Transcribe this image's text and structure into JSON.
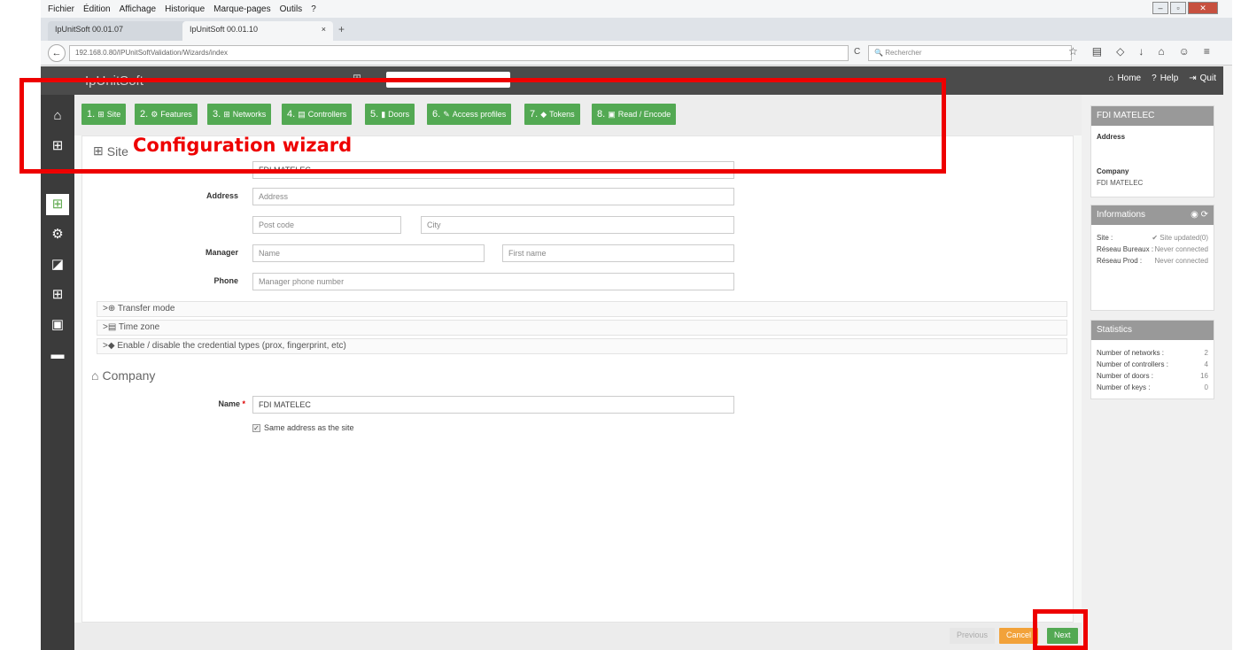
{
  "browser": {
    "menu": [
      "Fichier",
      "Édition",
      "Affichage",
      "Historique",
      "Marque-pages",
      "Outils",
      "?"
    ],
    "tabs": [
      {
        "label": "IpUnitSoft 00.01.07",
        "close": "×"
      },
      {
        "label": "IpUnitSoft 00.01.10",
        "close": "×"
      }
    ],
    "new_tab": "+",
    "url": "192.168.0.80/IPUnitSoftValidation/Wizards/index",
    "search_placeholder": "Rechercher",
    "back": "←",
    "reload": "C"
  },
  "app": {
    "logo": "IpUnitSoft",
    "header_links": {
      "home": "Home",
      "help": "Help",
      "quit": "Quit"
    }
  },
  "wizard": {
    "steps": [
      {
        "num": "1.",
        "icon": "⊞",
        "label": "Site"
      },
      {
        "num": "2.",
        "icon": "⚙",
        "label": "Features"
      },
      {
        "num": "3.",
        "icon": "⊞",
        "label": "Networks"
      },
      {
        "num": "4.",
        "icon": "▤",
        "label": "Controllers"
      },
      {
        "num": "5.",
        "icon": "▮",
        "label": "Doors"
      },
      {
        "num": "6.",
        "icon": "✎",
        "label": "Access profiles"
      },
      {
        "num": "7.",
        "icon": "◆",
        "label": "Tokens"
      },
      {
        "num": "8.",
        "icon": "▣",
        "label": "Read / Encode"
      }
    ]
  },
  "site": {
    "title": "Site",
    "name_value": "FDI MATELEC",
    "address_label": "Address",
    "address_placeholder": "Address",
    "postcode_placeholder": "Post code",
    "city_placeholder": "City",
    "manager_label": "Manager",
    "manager_name_placeholder": "Name",
    "manager_firstname_placeholder": "First name",
    "phone_label": "Phone",
    "phone_placeholder": "Manager phone number"
  },
  "accordions": [
    {
      "icon": "⊕",
      "label": "Transfer mode"
    },
    {
      "icon": "▤",
      "label": "Time zone"
    },
    {
      "icon": "◆",
      "label": "Enable / disable the credential types (prox, fingerprint, etc)"
    }
  ],
  "company": {
    "title": "Company",
    "name_label": "Name",
    "required": "*",
    "name_value": "FDI MATELEC",
    "same_address_label": "Same address as the site",
    "same_address_checked": true
  },
  "footer": {
    "previous": "Previous",
    "cancel": "Cancel",
    "next": "Next"
  },
  "right_panel": {
    "site_box": {
      "title": "FDI MATELEC",
      "address_label": "Address",
      "company_label": "Company",
      "company_value": "FDI MATELEC"
    },
    "info_box": {
      "title": "Informations",
      "rows": [
        {
          "label": "Site :",
          "value": "✔ Site updated(0)"
        },
        {
          "label": "Réseau Bureaux :",
          "value": "Never connected"
        },
        {
          "label": "Réseau Prod :",
          "value": "Never connected"
        }
      ]
    },
    "stats_box": {
      "title": "Statistics",
      "rows": [
        {
          "label": "Number of networks :",
          "value": "2"
        },
        {
          "label": "Number of controllers :",
          "value": "4"
        },
        {
          "label": "Number of doors :",
          "value": "16"
        },
        {
          "label": "Number of keys :",
          "value": "0"
        }
      ]
    }
  },
  "annotation": {
    "text": "Configuration wizard",
    "color": "#e00000"
  },
  "colors": {
    "accent_green": "#53a953",
    "cancel_orange": "#f2a23a",
    "header_dark": "#4b4b4b",
    "sidebar_dark": "#3b3b3b"
  }
}
